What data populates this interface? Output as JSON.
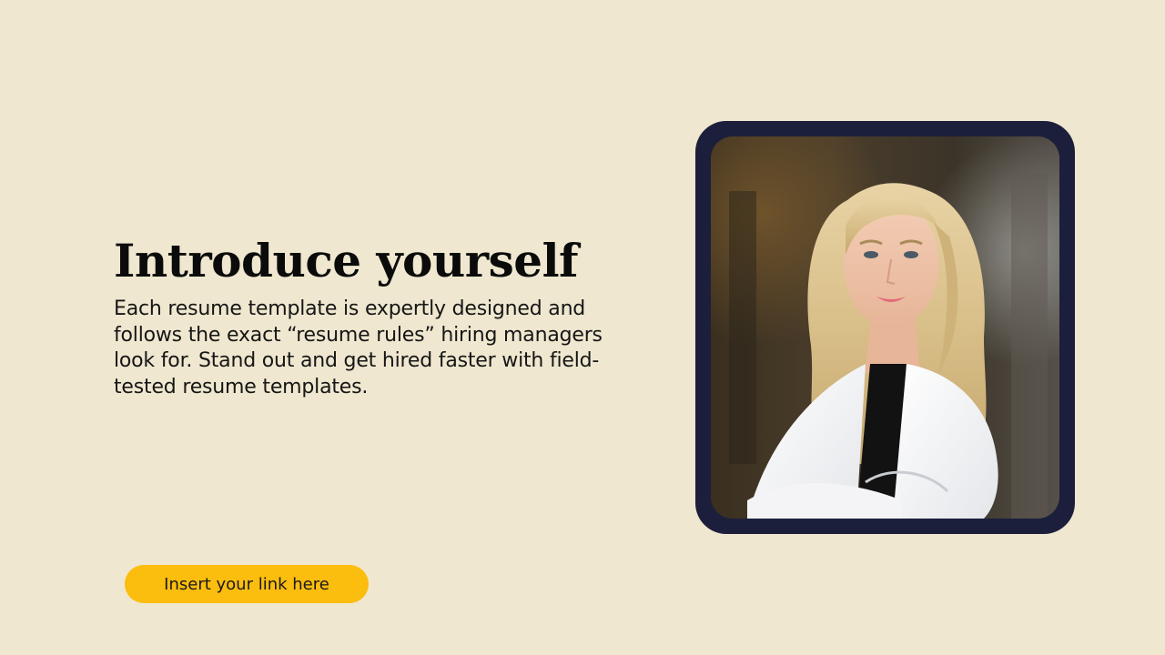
{
  "slide": {
    "title": "Introduce yourself",
    "body": "Each resume template is expertly designed and follows the exact “resume rules” hiring managers look for. Stand out and get hired faster with field-tested resume templates.",
    "cta_label": "Insert your link here"
  },
  "colors": {
    "background": "#efe7cf",
    "accent": "#fbbd0e",
    "frame": "#1c1f3b",
    "title_text": "#0b0b0b"
  },
  "image": {
    "subject": "portrait-photo"
  }
}
